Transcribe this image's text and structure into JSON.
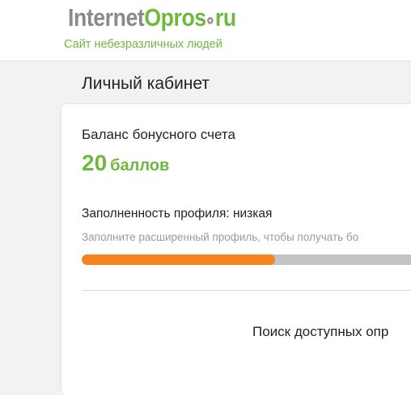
{
  "header": {
    "logo": {
      "part1": "Internet",
      "part2": "Opros",
      "part3": "ru"
    },
    "tagline": "Сайт небезразличных людей"
  },
  "page": {
    "title": "Личный кабинет"
  },
  "balance": {
    "label": "Баланс бонусного счета",
    "value": "20",
    "unit": "баллов"
  },
  "profile": {
    "completeness_label": "Заполненность профиля: низкая",
    "hint": "Заполните расширенный профиль, чтобы получать бо",
    "progress": 0.57
  },
  "survey": {
    "status": "Поиск доступных опр"
  },
  "colors": {
    "brand_green": "#6fb83f",
    "progress_orange": "#f5841f",
    "progress_track": "#c4c4c4"
  }
}
